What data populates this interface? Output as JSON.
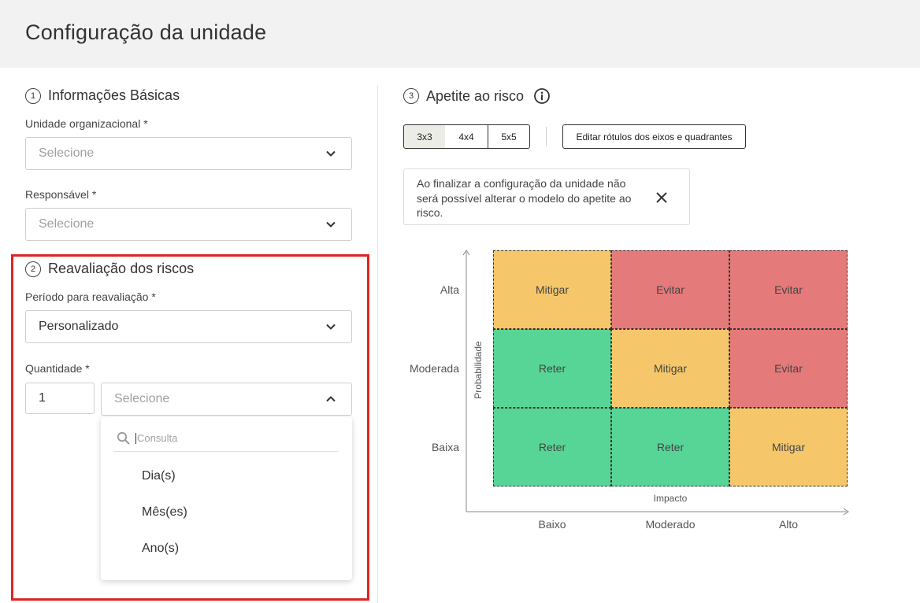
{
  "page_title": "Configuração da unidade",
  "sections": {
    "basic": {
      "number": "1",
      "title": "Informações Básicas"
    },
    "reassessment": {
      "number": "2",
      "title": "Reavaliação dos riscos"
    },
    "appetite": {
      "number": "3",
      "title": "Apetite ao risco"
    }
  },
  "basic_info": {
    "org_unit_label": "Unidade organizacional *",
    "org_unit_placeholder": "Selecione",
    "responsible_label": "Responsável *",
    "responsible_placeholder": "Selecione"
  },
  "reassessment": {
    "period_label": "Período para reavaliação *",
    "period_value": "Personalizado",
    "quantity_label": "Quantidade *",
    "quantity_value": "1",
    "unit_placeholder": "Selecione",
    "dropdown": {
      "search_placeholder": "Consulta",
      "options": [
        "Dia(s)",
        "Mês(es)",
        "Ano(s)"
      ]
    }
  },
  "appetite": {
    "matrix_sizes": [
      {
        "label": "3x3",
        "active": true
      },
      {
        "label": "4x4",
        "active": false
      },
      {
        "label": "5x5",
        "active": false
      }
    ],
    "edit_labels_button": "Editar rótulos dos eixos e quadrantes",
    "notice_text": "Ao finalizar a configuração da unidade não será possível alterar o modelo do apetite ao risco.",
    "y_axis_title": "Probabilidade",
    "x_axis_title": "Impacto",
    "y_levels": [
      "Alta",
      "Moderada",
      "Baixa"
    ],
    "x_levels": [
      "Baixo",
      "Moderado",
      "Alto"
    ],
    "matrix": [
      [
        "Mitigar",
        "Evitar",
        "Evitar"
      ],
      [
        "Reter",
        "Mitigar",
        "Evitar"
      ],
      [
        "Reter",
        "Reter",
        "Mitigar"
      ]
    ],
    "colors": {
      "Mitigar": "#f5c76a",
      "Evitar": "#e47a79",
      "Reter": "#57d597"
    }
  },
  "colors": {
    "highlight": "#e02424",
    "header_bg": "#f2f2f2"
  }
}
